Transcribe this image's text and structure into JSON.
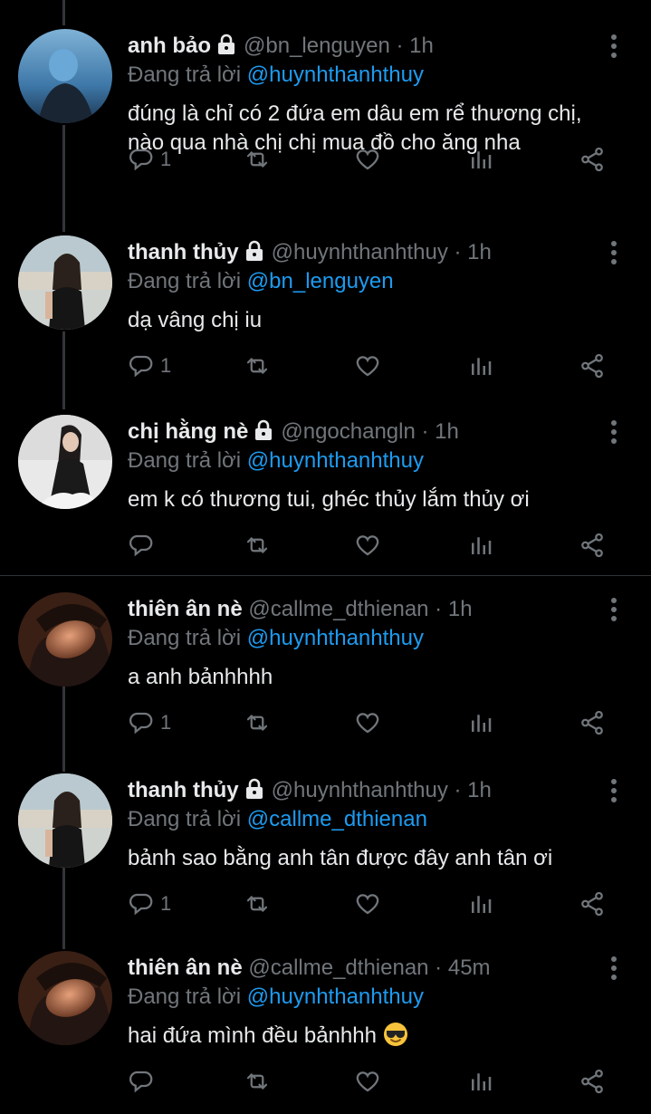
{
  "reply_label": "Đang trả lời",
  "emoji_sunglasses": "😎",
  "tweets": [
    {
      "name": "anh bảo",
      "locked": true,
      "handle": "@bn_lenguyen",
      "time": "1h",
      "reply_to": "@huynhthanhthuy",
      "lines": [
        "đúng là chỉ có 2 đứa em dâu em rể thương chị,",
        "nào qua nhà chị chị mua đồ cho ăng nha"
      ],
      "replies": "1",
      "avatar": "sea-blue"
    },
    {
      "name": "thanh thủy",
      "locked": true,
      "handle": "@huynhthanhthuy",
      "time": "1h",
      "reply_to": "@bn_lenguyen",
      "lines": [
        "dạ vâng chị iu"
      ],
      "replies": "1",
      "avatar": "beach-girl"
    },
    {
      "name": "chị hằng nè",
      "locked": true,
      "handle": "@ngochangln",
      "time": "1h",
      "reply_to": "@huynhthanhthuy",
      "lines": [
        "em k có thương tui, ghéc thủy lắm thủy ơi"
      ],
      "replies": "",
      "avatar": "white-room"
    },
    {
      "name": "thiên ân nè",
      "locked": false,
      "handle": "@callme_dthienan",
      "time": "1h",
      "reply_to": "@huynhthanhthuy",
      "lines": [
        "a anh bảnhhhh"
      ],
      "replies": "1",
      "avatar": "warm-face"
    },
    {
      "name": "thanh thủy",
      "locked": true,
      "handle": "@huynhthanhthuy",
      "time": "1h",
      "reply_to": "@callme_dthienan",
      "lines": [
        "bảnh sao bằng anh tân được đây anh tân ơi"
      ],
      "replies": "1",
      "avatar": "beach-girl"
    },
    {
      "name": "thiên ân nè",
      "locked": false,
      "handle": "@callme_dthienan",
      "time": "45m",
      "reply_to": "@huynhthanhthuy",
      "lines": [
        "hai đứa mình đều bảnhhh"
      ],
      "replies": "",
      "avatar": "warm-face",
      "emoji": true
    }
  ]
}
